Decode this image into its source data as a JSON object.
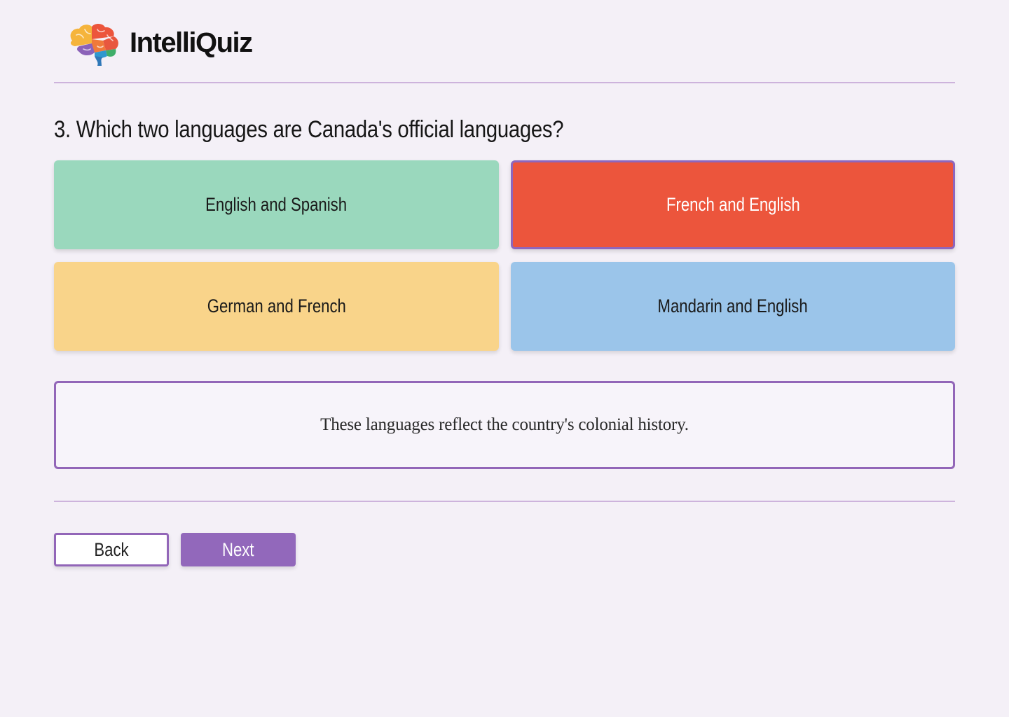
{
  "app": {
    "name": "IntelliQuiz",
    "logo_icon": "brain-icon"
  },
  "question": {
    "text": "3. Which two languages are Canada's official languages?"
  },
  "answers": [
    {
      "label": "English and Spanish",
      "color": "#9ad8bd",
      "selected": false
    },
    {
      "label": "French and English",
      "color": "#ec553c",
      "selected": true
    },
    {
      "label": "German and French",
      "color": "#f9d48a",
      "selected": false
    },
    {
      "label": "Mandarin and English",
      "color": "#9bc5ea",
      "selected": false
    }
  ],
  "hint": {
    "text": "These languages reflect the country's colonial history."
  },
  "navigation": {
    "back_label": "Back",
    "next_label": "Next"
  },
  "colors": {
    "background": "#f4f0f7",
    "accent": "#9266b8",
    "divider": "#cdb3dc"
  }
}
